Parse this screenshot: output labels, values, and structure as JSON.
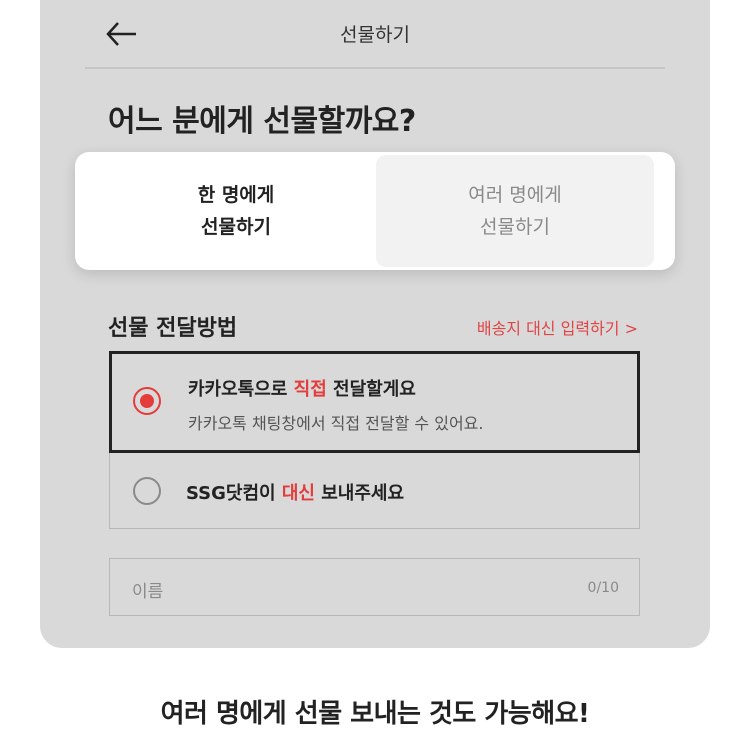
{
  "header": {
    "title": "선물하기",
    "back_icon": "arrow-left-icon"
  },
  "question": "어느 분에게 선물할까요?",
  "tabs": [
    {
      "line1": "한 명에게",
      "line2": "선물하기",
      "selected": true
    },
    {
      "line1": "여러 명에게",
      "line2": "선물하기",
      "selected": false
    }
  ],
  "delivery": {
    "title": "선물 전달방법",
    "address_link": "배송지 대신 입력하기 >",
    "options": [
      {
        "title_before": "카카오톡으로 ",
        "title_highlight": "직접",
        "title_after": " 전달할게요",
        "subtitle": "카카오톡 채팅창에서 직접 전달할 수 있어요.",
        "selected": true
      },
      {
        "title_before": "SSG닷컴이 ",
        "title_highlight": "대신",
        "title_after": " 보내주세요",
        "selected": false
      }
    ]
  },
  "name_field": {
    "placeholder": "이름",
    "counter": "0/10"
  },
  "caption": "여러 명에게 선물 보내는 것도 가능해요!",
  "colors": {
    "accent": "#e43b3b",
    "card_bg": "#d9d9d9",
    "text": "#222222"
  }
}
